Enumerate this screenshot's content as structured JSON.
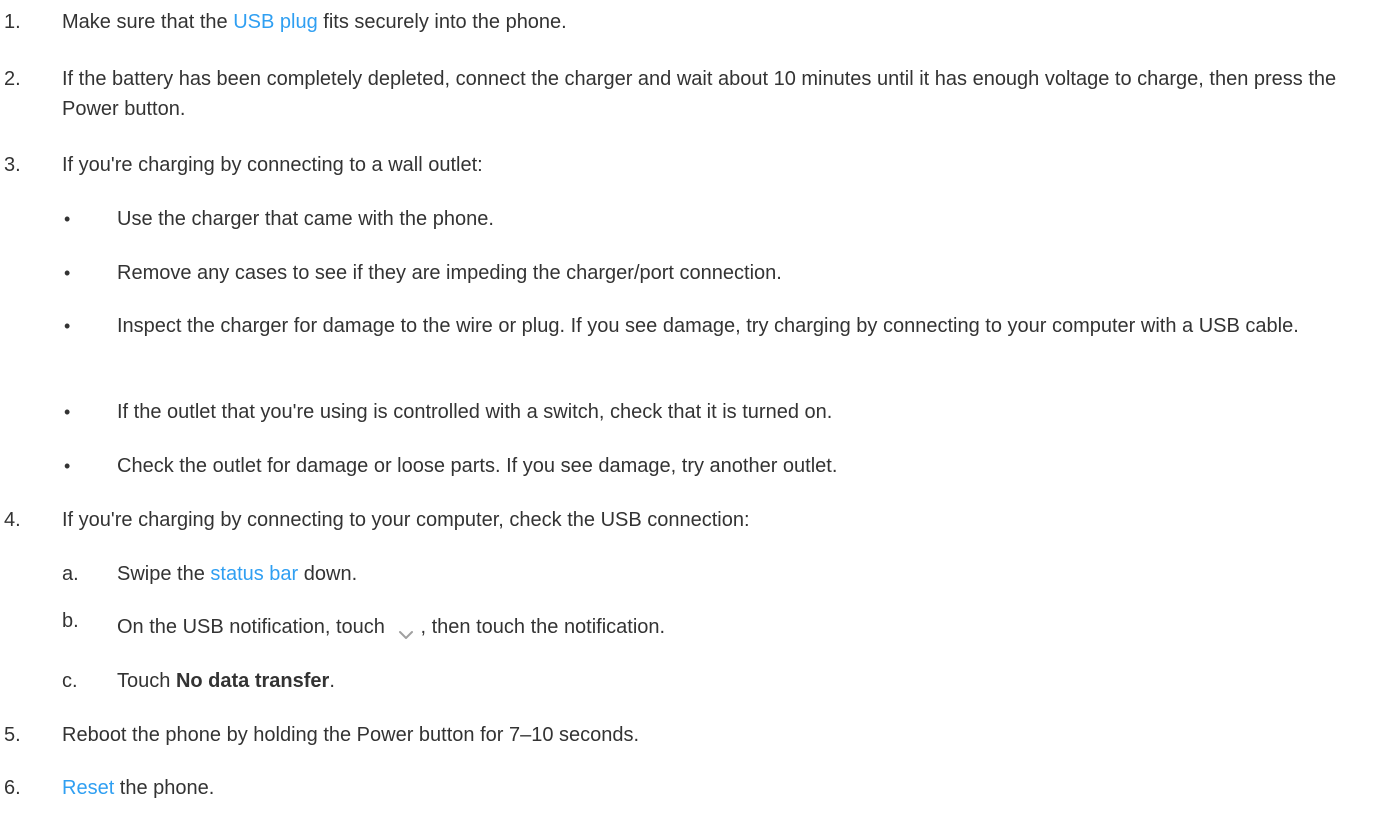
{
  "steps": {
    "s1": {
      "num": "1.",
      "pre": "Make sure that the ",
      "link": "USB plug",
      "post": " fits securely into the phone."
    },
    "s2": {
      "num": "2.",
      "text": "If the battery has been completely depleted, connect the charger and wait about 10 minutes until it has enough voltage to charge, then press the Power button."
    },
    "s3": {
      "num": "3.",
      "text": "If you're charging by connecting to a wall outlet:",
      "bullets": [
        "Use the charger that came with the phone.",
        "Remove any cases to see if they are impeding the charger/port connection.",
        "Inspect the charger for damage to the wire or plug. If you see damage, try charging by connecting to your computer with a USB cable.",
        "If the outlet that you're using is controlled with a switch, check that it is turned on.",
        "Check the outlet for damage or loose parts. If you see damage, try another outlet."
      ],
      "bullet_char": "•"
    },
    "s4": {
      "num": "4.",
      "text": "If you're charging by connecting to your computer, check the USB connection:",
      "a": {
        "letter": "a.",
        "pre": "Swipe the ",
        "link": "status bar",
        "post": " down."
      },
      "b": {
        "letter": "b.",
        "pre": "On the USB notification, touch",
        "icon": "chevron-down-icon",
        "post": ", then touch the notification."
      },
      "c": {
        "letter": "c.",
        "pre": "Touch ",
        "bold": "No data transfer",
        "post": "."
      }
    },
    "s5": {
      "num": "5.",
      "text": "Reboot the phone by holding the Power button for 7–10 seconds."
    },
    "s6": {
      "num": "6.",
      "link": "Reset",
      "post": " the phone."
    }
  },
  "colors": {
    "text": "#333333",
    "link": "#2f9ff2",
    "icon": "#a0a0a0"
  }
}
